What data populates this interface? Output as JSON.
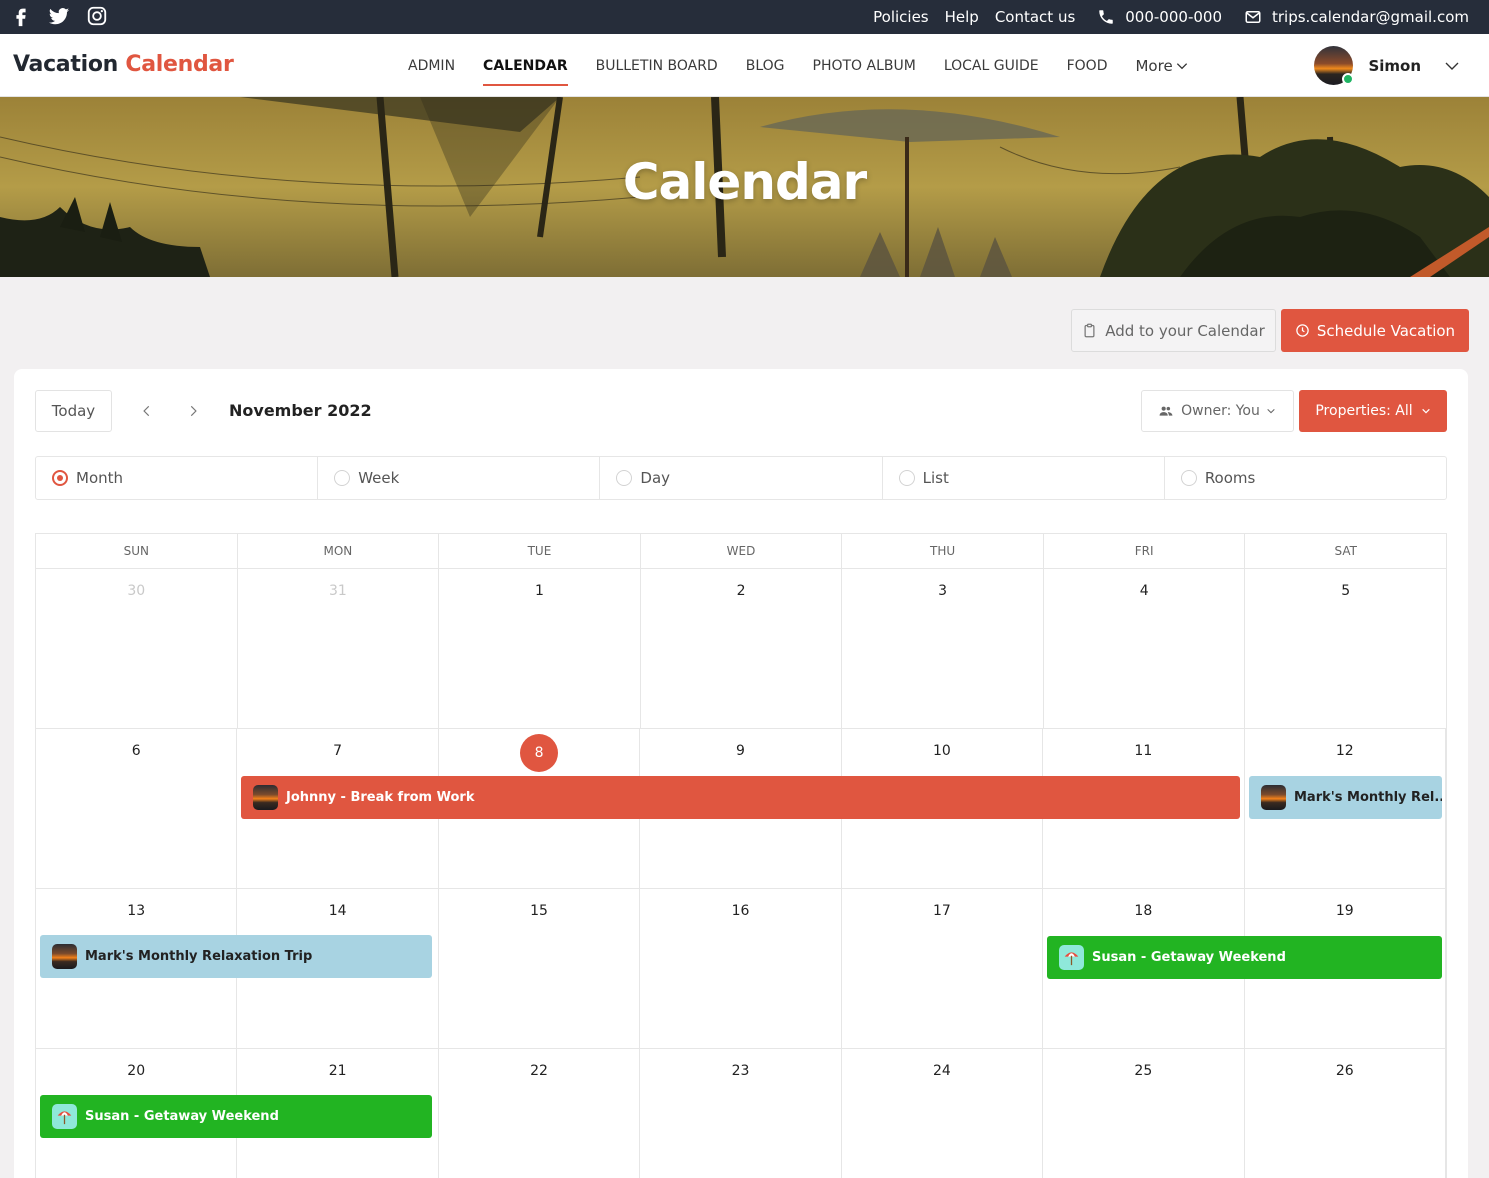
{
  "topbar": {
    "social": [
      "facebook-icon",
      "twitter-icon",
      "instagram-icon"
    ],
    "links": [
      "Policies",
      "Help",
      "Contact us"
    ],
    "phone": "000-000-000",
    "email": "trips.calendar@gmail.com"
  },
  "header": {
    "logo_part1": "Vacation",
    "logo_part2": "Calendar",
    "nav": [
      "ADMIN",
      "CALENDAR",
      "BULLETIN BOARD",
      "BLOG",
      "PHOTO ALBUM",
      "LOCAL GUIDE",
      "FOOD"
    ],
    "active_nav": "CALENDAR",
    "more_label": "More",
    "user_name": "Simon"
  },
  "hero": {
    "title": "Calendar"
  },
  "actions": {
    "add_label": "Add to your Calendar",
    "schedule_label": "Schedule Vacation"
  },
  "calendar": {
    "today_label": "Today",
    "month_title": "November 2022",
    "owner_label": "Owner: You",
    "properties_label": "Properties: All",
    "views": [
      "Month",
      "Week",
      "Day",
      "List",
      "Rooms"
    ],
    "selected_view": "Month",
    "weekdays": [
      "SUN",
      "MON",
      "TUE",
      "WED",
      "THU",
      "FRI",
      "SAT"
    ],
    "weeks": [
      [
        "30",
        "31",
        "1",
        "2",
        "3",
        "4",
        "5"
      ],
      [
        "6",
        "7",
        "8",
        "9",
        "10",
        "11",
        "12"
      ],
      [
        "13",
        "14",
        "15",
        "16",
        "17",
        "18",
        "19"
      ],
      [
        "20",
        "21",
        "22",
        "23",
        "24",
        "25",
        "26"
      ]
    ],
    "today": "8",
    "events": [
      {
        "title": "Johnny - Break from Work",
        "color": "#e05640",
        "thumb": "sunset"
      },
      {
        "title": "Mark's Monthly Rel...",
        "color": "#a8d3e2",
        "thumb": "sunset"
      },
      {
        "title": "Mark's Monthly Relaxation Trip",
        "color": "#a8d3e2",
        "thumb": "sunset"
      },
      {
        "title": "Susan - Getaway Weekend",
        "color": "#22b422",
        "thumb": "beach"
      },
      {
        "title": "Susan - Getaway Weekend",
        "color": "#22b422",
        "thumb": "beach"
      }
    ]
  },
  "colors": {
    "accent": "#e05640",
    "topbar": "#262d3a",
    "green": "#22b422",
    "blue": "#a8d3e2"
  }
}
